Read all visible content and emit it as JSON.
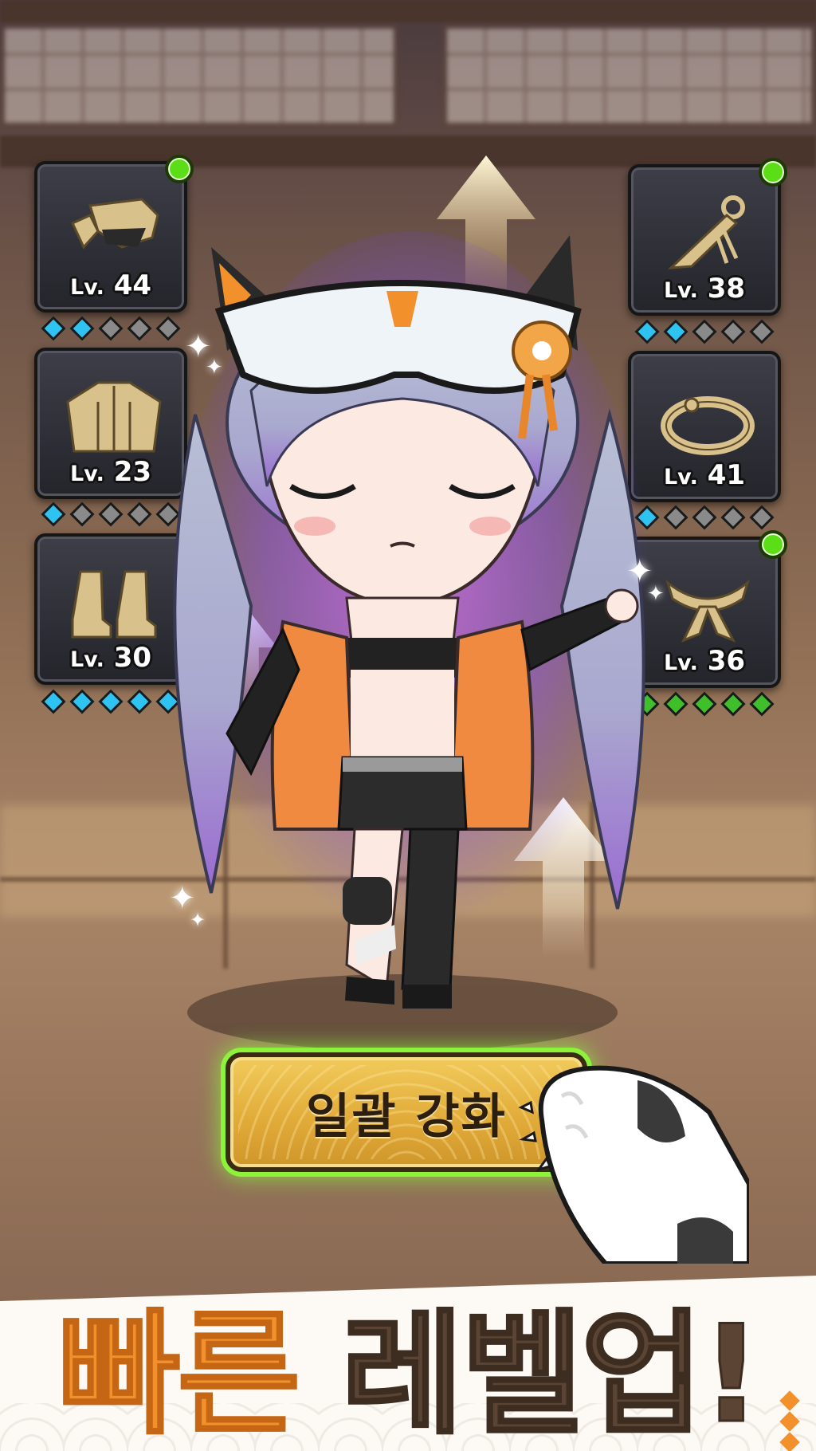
{
  "equipment_left": [
    {
      "slot": "hat",
      "lv_prefix": "Lv.",
      "level": "44",
      "gems": [
        "cyan",
        "cyan",
        "grey",
        "grey",
        "grey"
      ],
      "notify": true
    },
    {
      "slot": "armor",
      "lv_prefix": "Lv.",
      "level": "23",
      "gems": [
        "cyan",
        "grey",
        "grey",
        "grey",
        "grey"
      ],
      "notify": false
    },
    {
      "slot": "boots",
      "lv_prefix": "Lv.",
      "level": "30",
      "gems": [
        "cyan",
        "cyan",
        "cyan",
        "cyan",
        "cyan"
      ],
      "notify": false
    }
  ],
  "equipment_right": [
    {
      "slot": "weapon",
      "lv_prefix": "Lv.",
      "level": "38",
      "gems": [
        "cyan",
        "cyan",
        "grey",
        "grey",
        "grey"
      ],
      "notify": true
    },
    {
      "slot": "ring",
      "lv_prefix": "Lv.",
      "level": "41",
      "gems": [
        "cyan",
        "grey",
        "grey",
        "grey",
        "grey"
      ],
      "notify": false
    },
    {
      "slot": "scarf",
      "lv_prefix": "Lv.",
      "level": "36",
      "gems": [
        "green",
        "green",
        "green",
        "green",
        "green"
      ],
      "notify": true
    }
  ],
  "upgrade_button": {
    "label": "일괄 강화"
  },
  "headline": {
    "word1": "빠른",
    "word2": "레벨업!"
  },
  "colors": {
    "accent_orange": "#f2902c",
    "headline_brown": "#5b4433",
    "notify_green": "#5cde17",
    "button_gold": "#e2ac3a"
  },
  "icons": [
    "hat-icon",
    "armor-icon",
    "boots-icon",
    "kunai-icon",
    "ring-icon",
    "scarf-icon",
    "cat-paw-icon",
    "up-arrow-icon",
    "sparkle-icon"
  ]
}
